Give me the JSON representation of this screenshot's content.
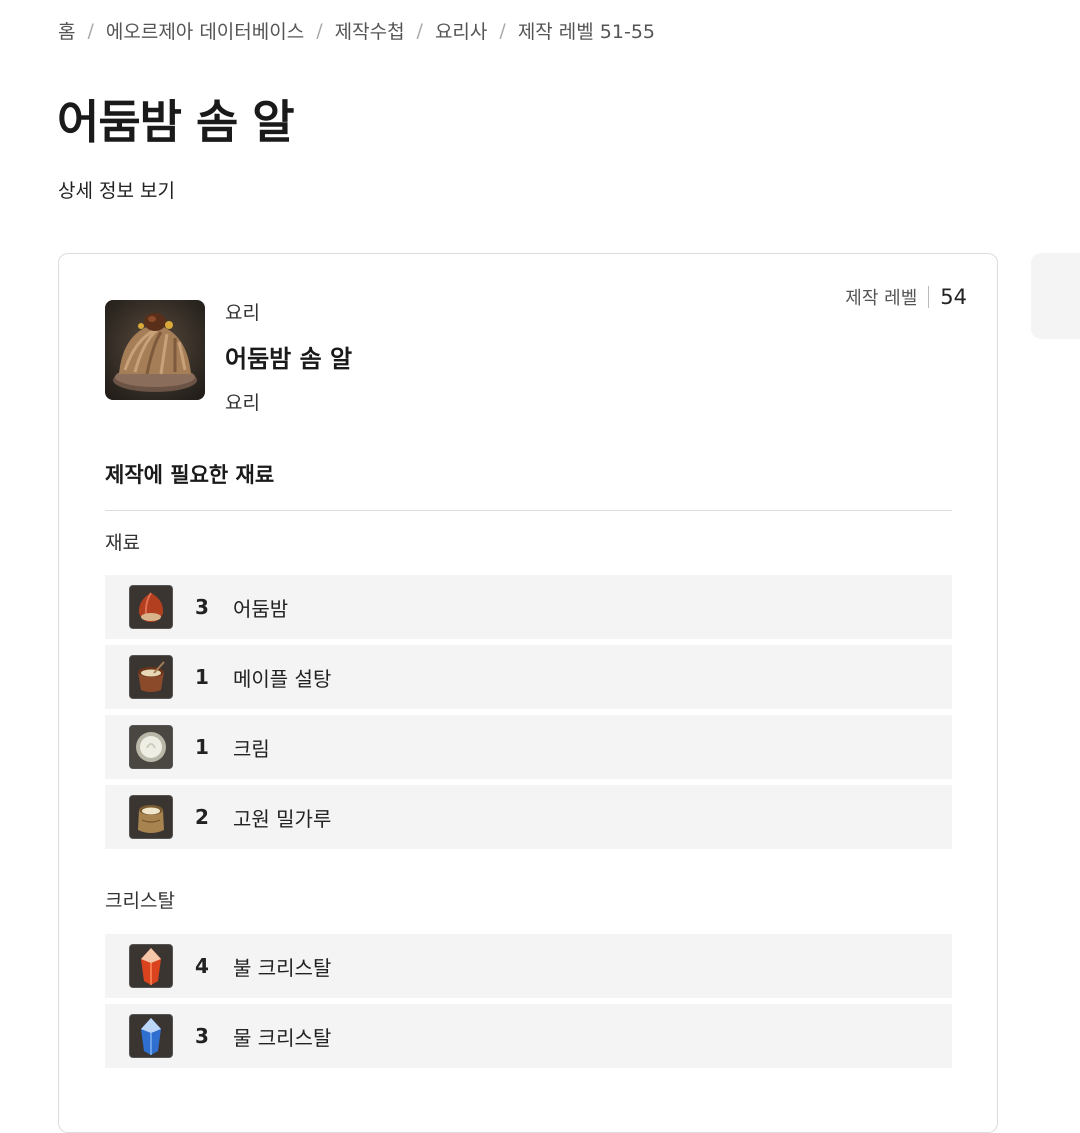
{
  "breadcrumb": [
    {
      "label": "홈"
    },
    {
      "label": "에오르제아 데이터베이스"
    },
    {
      "label": "제작수첩"
    },
    {
      "label": "요리사"
    },
    {
      "label": "제작 레벨 51-55"
    }
  ],
  "page": {
    "title": "어둠밤 솜 알",
    "detail_link": "상세 정보 보기"
  },
  "card": {
    "level_label": "제작 레벨",
    "level_value": "54",
    "item": {
      "category_top": "요리",
      "name": "어둠밤 솜 알",
      "category_bottom": "요리",
      "icon": "chestnut-mont-blanc-icon"
    },
    "section_title": "제작에 필요한 재료",
    "materials_label": "재료",
    "materials": [
      {
        "qty": "3",
        "name": "어둠밤",
        "icon": "chestnut-icon"
      },
      {
        "qty": "1",
        "name": "메이플 설탕",
        "icon": "maple-sugar-icon"
      },
      {
        "qty": "1",
        "name": "크림",
        "icon": "cream-icon"
      },
      {
        "qty": "2",
        "name": "고원 밀가루",
        "icon": "flour-icon"
      }
    ],
    "crystals_label": "크리스탈",
    "crystals": [
      {
        "qty": "4",
        "name": "불 크리스탈",
        "icon": "fire-crystal-icon"
      },
      {
        "qty": "3",
        "name": "물 크리스탈",
        "icon": "water-crystal-icon"
      }
    ]
  }
}
